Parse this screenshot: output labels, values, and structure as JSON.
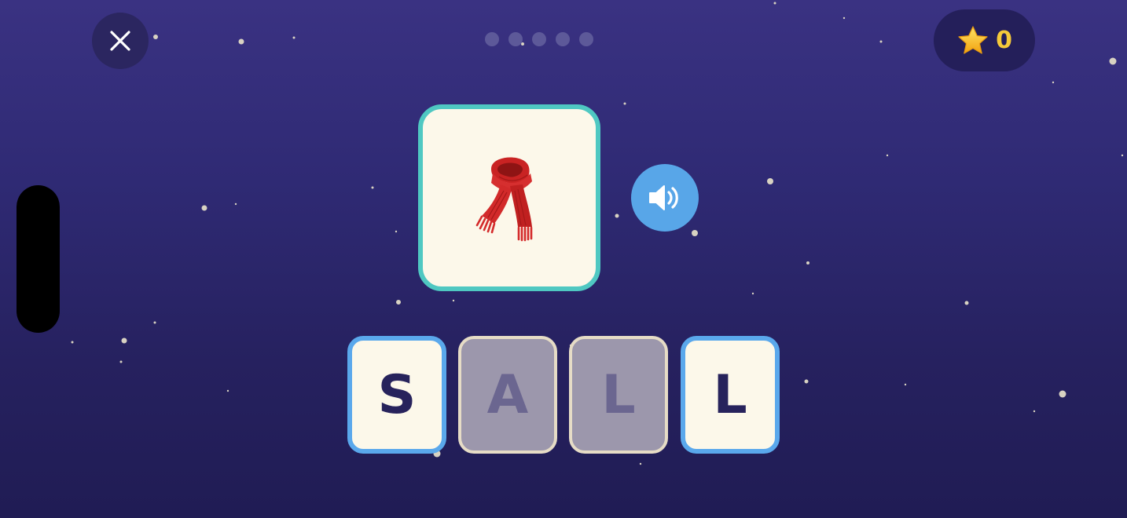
{
  "top_bar": {
    "close_icon": "close-x-icon",
    "progress": {
      "total_steps": 5,
      "current_step": 0
    },
    "score": {
      "icon": "star-icon",
      "value": "0"
    }
  },
  "prompt": {
    "image_icon": "red-scarf-emoji",
    "image_emoji": "🧣",
    "sound_icon": "speaker-icon"
  },
  "word_tiles": [
    {
      "letter": "S",
      "state": "filled"
    },
    {
      "letter": "A",
      "state": "empty"
    },
    {
      "letter": "L",
      "state": "empty"
    },
    {
      "letter": "L",
      "state": "filled"
    }
  ],
  "colors": {
    "background_top": "#3a3282",
    "background_bottom": "#201c54",
    "card_border": "#4fc8c2",
    "sound_button": "#58a6e8",
    "filled_tile_border": "#5aa8ec",
    "empty_tile_fill": "#9c97ac",
    "score_text": "#f5c93a"
  }
}
